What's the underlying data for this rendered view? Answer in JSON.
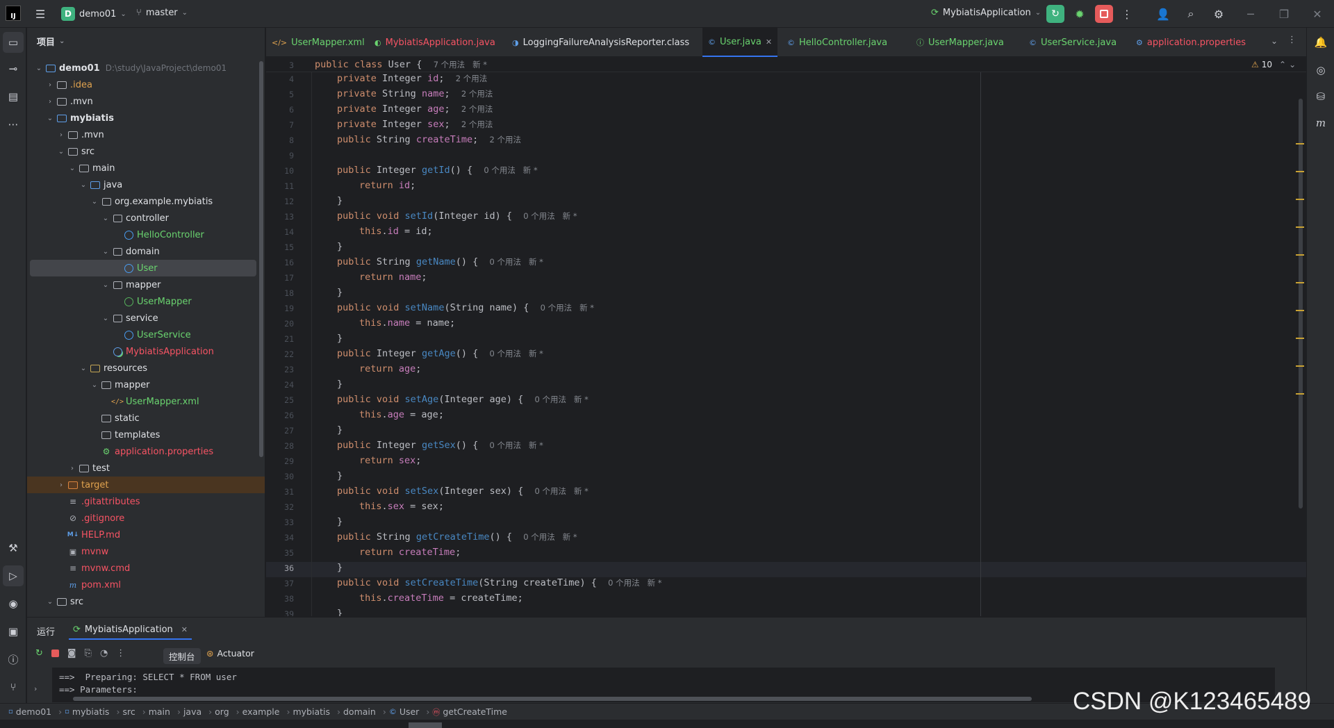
{
  "titlebar": {
    "project_initial": "D",
    "project_name": "demo01",
    "branch": "master",
    "run_config": "MybiatisApplication"
  },
  "project_panel": {
    "title": "项目"
  },
  "tree": [
    {
      "label": "demo01",
      "path": "D:\\study\\JavaProject\\demo01",
      "level": 0,
      "arrow": "v",
      "icon": "folder-module",
      "color": "#dfe1e5",
      "bold": true
    },
    {
      "label": ".idea",
      "level": 1,
      "arrow": ">",
      "icon": "folder",
      "color": "#e0a34f"
    },
    {
      "label": ".mvn",
      "level": 1,
      "arrow": ">",
      "icon": "folder",
      "color": "#dfe1e5"
    },
    {
      "label": "mybiatis",
      "level": 1,
      "arrow": "v",
      "icon": "folder-module",
      "color": "#dfe1e5",
      "bold": true
    },
    {
      "label": ".mvn",
      "level": 2,
      "arrow": ">",
      "icon": "folder",
      "color": "#dfe1e5"
    },
    {
      "label": "src",
      "level": 2,
      "arrow": "v",
      "icon": "folder",
      "color": "#dfe1e5"
    },
    {
      "label": "main",
      "level": 3,
      "arrow": "v",
      "icon": "folder",
      "color": "#dfe1e5"
    },
    {
      "label": "java",
      "level": 4,
      "arrow": "v",
      "icon": "folder-blue",
      "color": "#dfe1e5"
    },
    {
      "label": "org.example.mybiatis",
      "level": 5,
      "arrow": "v",
      "icon": "package",
      "color": "#dfe1e5"
    },
    {
      "label": "controller",
      "level": 6,
      "arrow": "v",
      "icon": "package",
      "color": "#dfe1e5"
    },
    {
      "label": "HelloController",
      "level": 7,
      "arrow": "",
      "icon": "class",
      "color": "#6ad46f"
    },
    {
      "label": "domain",
      "level": 6,
      "arrow": "v",
      "icon": "package",
      "color": "#dfe1e5"
    },
    {
      "label": "User",
      "level": 7,
      "arrow": "",
      "icon": "class",
      "color": "#6ad46f",
      "selected": true
    },
    {
      "label": "mapper",
      "level": 6,
      "arrow": "v",
      "icon": "package",
      "color": "#dfe1e5"
    },
    {
      "label": "UserMapper",
      "level": 7,
      "arrow": "",
      "icon": "interface",
      "color": "#6ad46f"
    },
    {
      "label": "service",
      "level": 6,
      "arrow": "v",
      "icon": "package",
      "color": "#dfe1e5"
    },
    {
      "label": "UserService",
      "level": 7,
      "arrow": "",
      "icon": "class",
      "color": "#6ad46f"
    },
    {
      "label": "MybiatisApplication",
      "level": 6,
      "arrow": "",
      "icon": "spring-class",
      "color": "#f75464"
    },
    {
      "label": "resources",
      "level": 4,
      "arrow": "v",
      "icon": "folder-res",
      "color": "#dfe1e5"
    },
    {
      "label": "mapper",
      "level": 5,
      "arrow": "v",
      "icon": "folder",
      "color": "#dfe1e5"
    },
    {
      "label": "UserMapper.xml",
      "level": 6,
      "arrow": "",
      "icon": "xml",
      "color": "#6ad46f"
    },
    {
      "label": "static",
      "level": 5,
      "arrow": "",
      "icon": "folder",
      "color": "#dfe1e5"
    },
    {
      "label": "templates",
      "level": 5,
      "arrow": "",
      "icon": "folder",
      "color": "#dfe1e5"
    },
    {
      "label": "application.properties",
      "level": 5,
      "arrow": "",
      "icon": "spring-props",
      "color": "#f75464"
    },
    {
      "label": "test",
      "level": 3,
      "arrow": ">",
      "icon": "folder",
      "color": "#dfe1e5"
    },
    {
      "label": "target",
      "level": 2,
      "arrow": ">",
      "icon": "folder-excluded",
      "color": "#e0a34f",
      "excluded": true
    },
    {
      "label": ".gitattributes",
      "level": 2,
      "arrow": "",
      "icon": "text",
      "color": "#f75464"
    },
    {
      "label": ".gitignore",
      "level": 2,
      "arrow": "",
      "icon": "ignore",
      "color": "#f75464"
    },
    {
      "label": "HELP.md",
      "level": 2,
      "arrow": "",
      "icon": "markdown",
      "color": "#f75464"
    },
    {
      "label": "mvnw",
      "level": 2,
      "arrow": "",
      "icon": "terminal",
      "color": "#f75464"
    },
    {
      "label": "mvnw.cmd",
      "level": 2,
      "arrow": "",
      "icon": "text",
      "color": "#f75464"
    },
    {
      "label": "pom.xml",
      "level": 2,
      "arrow": "",
      "icon": "maven",
      "color": "#f75464"
    },
    {
      "label": "src",
      "level": 1,
      "arrow": "v",
      "icon": "folder",
      "color": "#dfe1e5"
    }
  ],
  "tabs": [
    {
      "label": "UserMapper.xml",
      "icon": "xml-icon",
      "color": "#6ad46f"
    },
    {
      "label": "MybiatisApplication.java",
      "icon": "spring-class-icon",
      "color": "#f75464"
    },
    {
      "label": "LoggingFailureAnalysisReporter.class",
      "icon": "class-file-icon",
      "color": "#dfe1e5"
    },
    {
      "label": "User.java",
      "icon": "class-icon",
      "color": "#6ad46f",
      "active": true
    },
    {
      "label": "HelloController.java",
      "icon": "class-icon",
      "color": "#6ad46f"
    },
    {
      "label": "UserMapper.java",
      "icon": "interface-icon",
      "color": "#6ad46f"
    },
    {
      "label": "UserService.java",
      "icon": "class-icon",
      "color": "#6ad46f"
    },
    {
      "label": "application.properties",
      "icon": "spring-props-icon",
      "color": "#f75464"
    }
  ],
  "editor": {
    "warning_count": "10",
    "current_line": 36
  },
  "code": [
    {
      "n": "3",
      "t": [
        [
          "kw",
          "public class "
        ],
        [
          "p",
          "User {  "
        ],
        [
          "h",
          "7 个用法   新 *"
        ]
      ],
      "indent": 0
    },
    {
      "n": "4",
      "t": [
        [
          "kw",
          "private "
        ],
        [
          "p",
          "Integer "
        ],
        [
          "fd",
          "id"
        ],
        [
          "p",
          ";  "
        ],
        [
          "h",
          "2 个用法"
        ]
      ],
      "indent": 1
    },
    {
      "n": "5",
      "t": [
        [
          "kw",
          "private "
        ],
        [
          "p",
          "String "
        ],
        [
          "fd",
          "name"
        ],
        [
          "p",
          ";  "
        ],
        [
          "h",
          "2 个用法"
        ]
      ],
      "indent": 1
    },
    {
      "n": "6",
      "t": [
        [
          "kw",
          "private "
        ],
        [
          "p",
          "Integer "
        ],
        [
          "fd",
          "age"
        ],
        [
          "p",
          ";  "
        ],
        [
          "h",
          "2 个用法"
        ]
      ],
      "indent": 1
    },
    {
      "n": "7",
      "t": [
        [
          "kw",
          "private "
        ],
        [
          "p",
          "Integer "
        ],
        [
          "fd",
          "sex"
        ],
        [
          "p",
          ";  "
        ],
        [
          "h",
          "2 个用法"
        ]
      ],
      "indent": 1
    },
    {
      "n": "8",
      "t": [
        [
          "kw",
          "public "
        ],
        [
          "p",
          "String "
        ],
        [
          "fd",
          "createTime"
        ],
        [
          "p",
          ";  "
        ],
        [
          "h",
          "2 个用法"
        ]
      ],
      "indent": 1
    },
    {
      "n": "9",
      "t": [],
      "indent": 1
    },
    {
      "n": "10",
      "t": [
        [
          "kw",
          "public "
        ],
        [
          "p",
          "Integer "
        ],
        [
          "fnu",
          "getId"
        ],
        [
          "p",
          "() {  "
        ],
        [
          "h",
          "0 个用法   新 *"
        ]
      ],
      "indent": 1
    },
    {
      "n": "11",
      "t": [
        [
          "kw",
          "return "
        ],
        [
          "fd",
          "id"
        ],
        [
          "p",
          ";"
        ]
      ],
      "indent": 2
    },
    {
      "n": "12",
      "t": [
        [
          "p",
          "}"
        ]
      ],
      "indent": 1
    },
    {
      "n": "13",
      "t": [
        [
          "kw",
          "public void "
        ],
        [
          "fnu",
          "setId"
        ],
        [
          "p",
          "(Integer id) {  "
        ],
        [
          "h",
          "0 个用法   新 *"
        ]
      ],
      "indent": 1
    },
    {
      "n": "14",
      "t": [
        [
          "kw",
          "this"
        ],
        [
          "p",
          "."
        ],
        [
          "fd",
          "id"
        ],
        [
          "p",
          " = id;"
        ]
      ],
      "indent": 2
    },
    {
      "n": "15",
      "t": [
        [
          "p",
          "}"
        ]
      ],
      "indent": 1
    },
    {
      "n": "16",
      "t": [
        [
          "kw",
          "public "
        ],
        [
          "p",
          "String "
        ],
        [
          "fnu",
          "getName"
        ],
        [
          "p",
          "() {  "
        ],
        [
          "h",
          "0 个用法   新 *"
        ]
      ],
      "indent": 1
    },
    {
      "n": "17",
      "t": [
        [
          "kw",
          "return "
        ],
        [
          "fd",
          "name"
        ],
        [
          "p",
          ";"
        ]
      ],
      "indent": 2
    },
    {
      "n": "18",
      "t": [
        [
          "p",
          "}"
        ]
      ],
      "indent": 1
    },
    {
      "n": "19",
      "t": [
        [
          "kw",
          "public void "
        ],
        [
          "fnu",
          "setName"
        ],
        [
          "p",
          "(String name) {  "
        ],
        [
          "h",
          "0 个用法   新 *"
        ]
      ],
      "indent": 1
    },
    {
      "n": "20",
      "t": [
        [
          "kw",
          "this"
        ],
        [
          "p",
          "."
        ],
        [
          "fd",
          "name"
        ],
        [
          "p",
          " = name;"
        ]
      ],
      "indent": 2
    },
    {
      "n": "21",
      "t": [
        [
          "p",
          "}"
        ]
      ],
      "indent": 1
    },
    {
      "n": "22",
      "t": [
        [
          "kw",
          "public "
        ],
        [
          "p",
          "Integer "
        ],
        [
          "fnu",
          "getAge"
        ],
        [
          "p",
          "() {  "
        ],
        [
          "h",
          "0 个用法   新 *"
        ]
      ],
      "indent": 1
    },
    {
      "n": "23",
      "t": [
        [
          "kw",
          "return "
        ],
        [
          "fd",
          "age"
        ],
        [
          "p",
          ";"
        ]
      ],
      "indent": 2
    },
    {
      "n": "24",
      "t": [
        [
          "p",
          "}"
        ]
      ],
      "indent": 1
    },
    {
      "n": "25",
      "t": [
        [
          "kw",
          "public void "
        ],
        [
          "fnu",
          "setAge"
        ],
        [
          "p",
          "(Integer age) {  "
        ],
        [
          "h",
          "0 个用法   新 *"
        ]
      ],
      "indent": 1
    },
    {
      "n": "26",
      "t": [
        [
          "kw",
          "this"
        ],
        [
          "p",
          "."
        ],
        [
          "fd",
          "age"
        ],
        [
          "p",
          " = age;"
        ]
      ],
      "indent": 2
    },
    {
      "n": "27",
      "t": [
        [
          "p",
          "}"
        ]
      ],
      "indent": 1
    },
    {
      "n": "28",
      "t": [
        [
          "kw",
          "public "
        ],
        [
          "p",
          "Integer "
        ],
        [
          "fnu",
          "getSex"
        ],
        [
          "p",
          "() {  "
        ],
        [
          "h",
          "0 个用法   新 *"
        ]
      ],
      "indent": 1
    },
    {
      "n": "29",
      "t": [
        [
          "kw",
          "return "
        ],
        [
          "fd",
          "sex"
        ],
        [
          "p",
          ";"
        ]
      ],
      "indent": 2
    },
    {
      "n": "30",
      "t": [
        [
          "p",
          "}"
        ]
      ],
      "indent": 1
    },
    {
      "n": "31",
      "t": [
        [
          "kw",
          "public void "
        ],
        [
          "fnu",
          "setSex"
        ],
        [
          "p",
          "(Integer sex) {  "
        ],
        [
          "h",
          "0 个用法   新 *"
        ]
      ],
      "indent": 1
    },
    {
      "n": "32",
      "t": [
        [
          "kw",
          "this"
        ],
        [
          "p",
          "."
        ],
        [
          "fd",
          "sex"
        ],
        [
          "p",
          " = sex;"
        ]
      ],
      "indent": 2
    },
    {
      "n": "33",
      "t": [
        [
          "p",
          "}"
        ]
      ],
      "indent": 1
    },
    {
      "n": "34",
      "t": [
        [
          "kw",
          "public "
        ],
        [
          "p",
          "String "
        ],
        [
          "fnu",
          "getCreateTime"
        ],
        [
          "p",
          "() {  "
        ],
        [
          "h",
          "0 个用法   新 *"
        ]
      ],
      "indent": 1
    },
    {
      "n": "35",
      "t": [
        [
          "kw",
          "return "
        ],
        [
          "fd",
          "createTime"
        ],
        [
          "p",
          ";"
        ]
      ],
      "indent": 2
    },
    {
      "n": "36",
      "t": [
        [
          "p",
          "}"
        ]
      ],
      "indent": 1
    },
    {
      "n": "37",
      "t": [
        [
          "kw",
          "public void "
        ],
        [
          "fnu",
          "setCreateTime"
        ],
        [
          "p",
          "(String createTime) {  "
        ],
        [
          "h",
          "0 个用法   新 *"
        ]
      ],
      "indent": 1
    },
    {
      "n": "38",
      "t": [
        [
          "kw",
          "this"
        ],
        [
          "p",
          "."
        ],
        [
          "fd",
          "createTime"
        ],
        [
          "p",
          " = createTime;"
        ]
      ],
      "indent": 2
    },
    {
      "n": "39",
      "t": [
        [
          "p",
          "}"
        ]
      ],
      "indent": 1
    }
  ],
  "run": {
    "tab_label": "运行",
    "config": "MybiatisApplication",
    "console_tab": "控制台",
    "actuator_tab": "Actuator",
    "lines": [
      "==>  Preparing: SELECT * FROM user",
      "==> Parameters:"
    ]
  },
  "breadcrumbs": [
    "demo01",
    "mybiatis",
    "src",
    "main",
    "java",
    "org",
    "example",
    "mybiatis",
    "domain",
    "User",
    "getCreateTime"
  ],
  "watermark": "CSDN @K123465489",
  "colors": {
    "accent": "#3574f0",
    "run_green": "#3fb27f",
    "stop_red": "#e55b5b"
  }
}
